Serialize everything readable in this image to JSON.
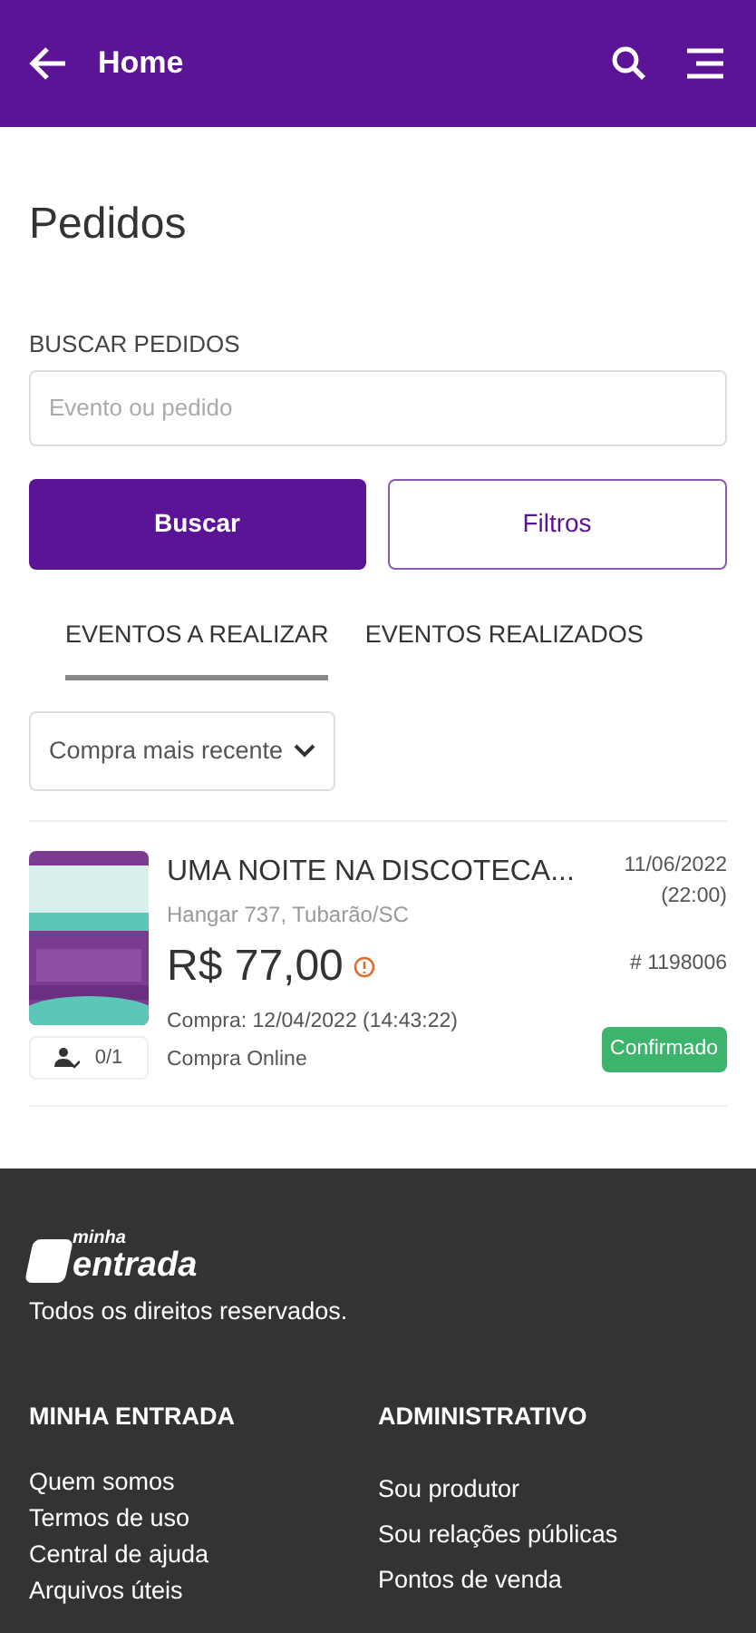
{
  "header": {
    "title": "Home"
  },
  "page_title": "Pedidos",
  "search": {
    "label": "BUSCAR PEDIDOS",
    "placeholder": "Evento ou pedido"
  },
  "buttons": [
    {
      "label": "Buscar",
      "kind": "primary"
    },
    {
      "label": "Filtros",
      "kind": "outline"
    }
  ],
  "tabs": [
    {
      "label": "EVENTOS A REALIZAR",
      "selected": true
    },
    {
      "label": "EVENTOS REALIZADOS",
      "selected": false
    }
  ],
  "sort": {
    "value": "Compra mais recente"
  },
  "orders": [
    {
      "title": "UMA NOITE NA DISCOTECA...",
      "venue": "Hangar 737, Tubarão/SC",
      "price": "R$ 77,00",
      "date": "11/06/2022",
      "time": "(22:00)",
      "number": "# 1198006",
      "purchase": "Compra: 12/04/2022 (14:43:22)",
      "channel": "Compra Online",
      "tickets": "0/1",
      "status": "Confirmado"
    }
  ],
  "footer": {
    "logo_top": "minha",
    "logo_bottom": "entrada",
    "copyright": "Todos os direitos reservados.",
    "columns": [
      {
        "heading": "MINHA ENTRADA",
        "links": [
          "Quem somos",
          "Termos de uso",
          "Central de ajuda",
          "Arquivos úteis"
        ]
      },
      {
        "heading": "ADMINISTRATIVO",
        "links": [
          "Sou produtor",
          "Sou relações públicas",
          "Pontos de venda"
        ]
      }
    ]
  }
}
